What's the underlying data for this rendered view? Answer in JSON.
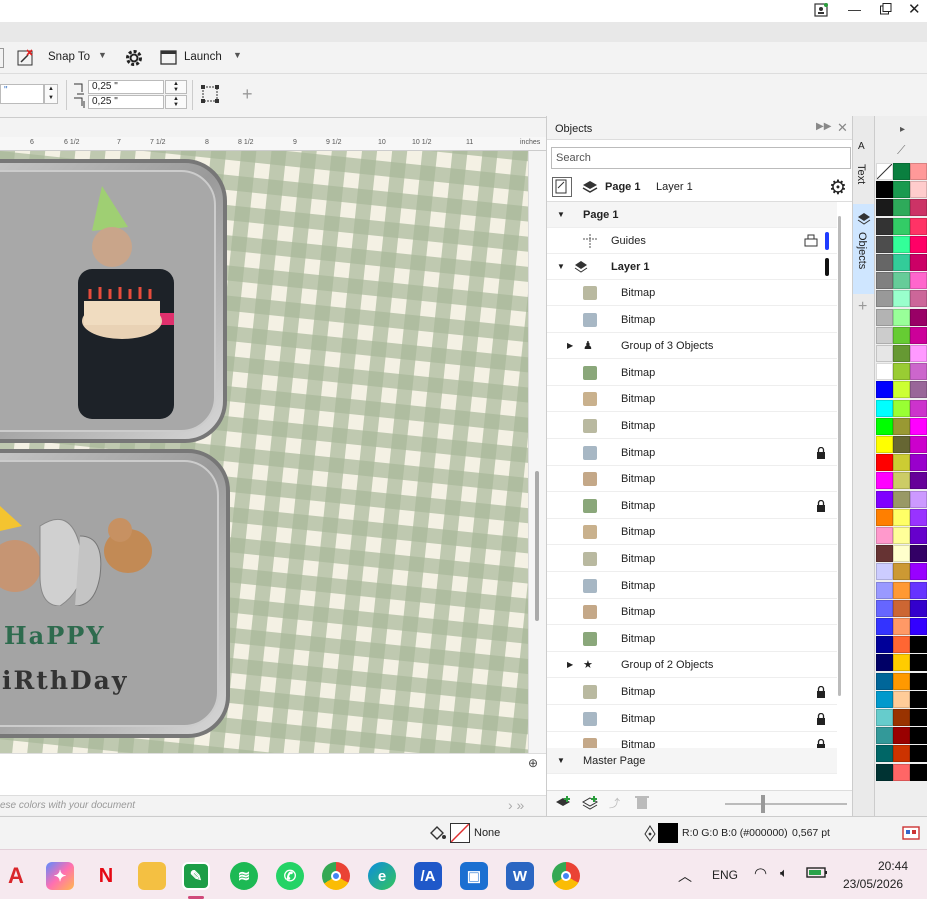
{
  "toolbar": {
    "snap_to_label": "Snap To",
    "launch_label": "Launch"
  },
  "toolbar2": {
    "nudge_x": "0,25 \"",
    "nudge_y": "0,25 \"",
    "left_value": "\""
  },
  "ruler": {
    "ticks": [
      "6",
      "6 1/2",
      "7",
      "7 1/2",
      "8",
      "8 1/2",
      "9",
      "9 1/2",
      "10",
      "10 1/2",
      "11"
    ],
    "unit": "inches"
  },
  "canvas": {
    "card_top_image": "birthday-man-with-cake",
    "card_bottom_text_line1": "HaPPY",
    "card_bottom_text_line2": "iRthDay"
  },
  "objects_panel": {
    "title": "Objects",
    "search_placeholder": "Search",
    "page_label": "Page 1",
    "layer_label": "Layer 1",
    "tree": {
      "page_node": "Page 1",
      "guides": "Guides",
      "layer_node": "Layer 1",
      "items": [
        {
          "label": "Bitmap",
          "icon": "bitmap-icon",
          "locked": false,
          "expandable": false
        },
        {
          "label": "Bitmap",
          "icon": "bitmap-icon",
          "locked": false,
          "expandable": false
        },
        {
          "label": "Group of 3 Objects",
          "icon": "group-icon",
          "locked": false,
          "expandable": true
        },
        {
          "label": "Bitmap",
          "icon": "bitmap-icon",
          "locked": false,
          "expandable": false
        },
        {
          "label": "Bitmap",
          "icon": "bitmap-icon",
          "locked": false,
          "expandable": false
        },
        {
          "label": "Bitmap",
          "icon": "bitmap-icon",
          "locked": false,
          "expandable": false
        },
        {
          "label": "Bitmap",
          "icon": "bitmap-icon",
          "locked": true,
          "expandable": false
        },
        {
          "label": "Bitmap",
          "icon": "bitmap-icon",
          "locked": false,
          "expandable": false
        },
        {
          "label": "Bitmap",
          "icon": "bitmap-icon",
          "locked": true,
          "expandable": false
        },
        {
          "label": "Bitmap",
          "icon": "bitmap-icon",
          "locked": false,
          "expandable": false
        },
        {
          "label": "Bitmap",
          "icon": "bitmap-icon",
          "locked": false,
          "expandable": false
        },
        {
          "label": "Bitmap",
          "icon": "bitmap-icon",
          "locked": false,
          "expandable": false
        },
        {
          "label": "Bitmap",
          "icon": "bitmap-icon",
          "locked": false,
          "expandable": false
        },
        {
          "label": "Bitmap",
          "icon": "bitmap-icon",
          "locked": false,
          "expandable": false
        },
        {
          "label": "Group of 2 Objects",
          "icon": "group-icon",
          "locked": false,
          "expandable": true
        },
        {
          "label": "Bitmap",
          "icon": "bitmap-icon",
          "locked": true,
          "expandable": false
        },
        {
          "label": "Bitmap",
          "icon": "bitmap-icon",
          "locked": true,
          "expandable": false
        },
        {
          "label": "Bitmap",
          "icon": "bitmap-icon",
          "locked": true,
          "expandable": false
        }
      ],
      "master_page": "Master Page"
    }
  },
  "side_tabs": {
    "text": "Text",
    "objects": "Objects"
  },
  "palette": {
    "columns": [
      [
        "#ffffff",
        "#000000",
        "#1a1a1a",
        "#333333",
        "#4d4d4d",
        "#666666",
        "#808080",
        "#999999",
        "#b3b3b3",
        "#cccccc",
        "#e6e6e6",
        "#ffffff",
        "#0000ff",
        "#00ffff",
        "#00ff00",
        "#ffff00",
        "#ff0000",
        "#ff00ff",
        "#7f00ff",
        "#ff7f00",
        "#ff99cc",
        "#663333",
        "#ccccff",
        "#9999ff",
        "#6666ff",
        "#3333ff",
        "#000099",
        "#000066",
        "#006699",
        "#0099cc",
        "#66cccc",
        "#339999",
        "#006666",
        "#003333"
      ],
      [
        "#0a7f3f",
        "#1a9a4f",
        "#2eaa5a",
        "#33cc66",
        "#33ff99",
        "#33cc99",
        "#66cc99",
        "#99ffcc",
        "#99ff99",
        "#66cc33",
        "#669933",
        "#99cc33",
        "#ccff33",
        "#99ff33",
        "#999933",
        "#666633",
        "#cccc33",
        "#cccc66",
        "#999966",
        "#ffff66",
        "#ffff99",
        "#ffffcc",
        "#cc9933",
        "#ff9933",
        "#cc6633",
        "#ff9966",
        "#ff6633",
        "#ffcc00",
        "#ff9900",
        "#ffcc99",
        "#993300",
        "#990000",
        "#cc3300",
        "#ff6666"
      ],
      [
        "#ff9999",
        "#ffcccc",
        "#cc3366",
        "#ff3366",
        "#ff0066",
        "#cc0066",
        "#ff66cc",
        "#cc6699",
        "#990066",
        "#cc0099",
        "#ff99ff",
        "#cc66cc",
        "#996699",
        "#cc33cc",
        "#ff00ff",
        "#cc00cc",
        "#9900cc",
        "#660099",
        "#cc99ff",
        "#9933ff",
        "#6600cc",
        "#330066",
        "#9900ff",
        "#6633ff",
        "#3300cc",
        "#3300ff",
        "#000000",
        "#000000",
        "#000000",
        "#000000",
        "#000000",
        "#000000",
        "#000000",
        "#000000"
      ]
    ]
  },
  "statusbar": {
    "fill_label": "None",
    "outline_rgb": "R:0 G:0 B:0 (#000000)",
    "outline_width": "0,567 pt"
  },
  "color_hint": "ese colors with your document",
  "taskbar": {
    "language": "ENG",
    "time": "20:44",
    "date": "23/05/2026"
  }
}
